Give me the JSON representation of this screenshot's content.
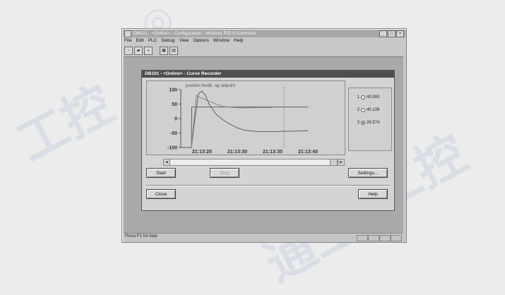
{
  "window": {
    "title": "DB101 - <Online> - Configuration - Modular PID 5 Controller",
    "menus": [
      "File",
      "Edit",
      "PLC",
      "Debug",
      "View",
      "Options",
      "Window",
      "Help"
    ],
    "toolbar_icons": [
      "new-file-icon",
      "open-folder-icon",
      "save-icon",
      "monitor-icon",
      "curve-recorder-icon"
    ]
  },
  "dialog": {
    "title": "DB101 - <Online> - Curve Recorder",
    "legend": "position feedb. og setpoint",
    "values": [
      {
        "index": "1",
        "value": "40.000",
        "selected": false
      },
      {
        "index": "2",
        "value": "40.139",
        "selected": false
      },
      {
        "index": "3",
        "value": "26.574",
        "selected": true
      }
    ],
    "buttons": {
      "start": "Start",
      "stop": "Stop",
      "settings": "Settings...",
      "close": "Close",
      "help": "Help"
    }
  },
  "chart_data": {
    "type": "line",
    "title": "",
    "legend_text": "position feedb. og setpoint",
    "xlabel": "",
    "ylabel": "",
    "x_ticks": [
      "21:13:25",
      "21:13:30",
      "21:13:35",
      "21:13:40"
    ],
    "y_ticks": [
      "100",
      "50",
      "0",
      "-50",
      "-100"
    ],
    "ylim": [
      -100,
      100
    ],
    "x_seconds_range": [
      22,
      43
    ],
    "series": [
      {
        "x": [
          22,
          23.5,
          23.55,
          40
        ],
        "values": [
          -100,
          -100,
          40,
          40
        ]
      },
      {
        "x": [
          23.5,
          24,
          24.5,
          25,
          25.5,
          26,
          27,
          28,
          29,
          30,
          31,
          33,
          35,
          37,
          40
        ],
        "values": [
          -100,
          0,
          85,
          95,
          80,
          50,
          15,
          -5,
          -20,
          -32,
          -40,
          -45,
          -45,
          -44,
          -42
        ]
      },
      {
        "x": [
          23.5,
          24.2,
          25,
          26,
          27,
          28,
          29.5,
          31,
          33,
          35
        ],
        "values": [
          -100,
          80,
          70,
          60,
          50,
          42,
          38,
          37,
          38,
          38
        ]
      }
    ],
    "series_colors": [
      "#5a5a5a",
      "#666666",
      "#8c8c8c"
    ],
    "cursor_x": 36.6,
    "grid": false
  },
  "statusbar": {
    "text": "Press F1 for help"
  }
}
